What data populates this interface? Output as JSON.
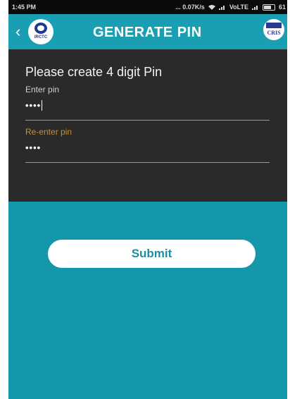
{
  "status_bar": {
    "time": "1:45 PM",
    "network_speed": "... 0.07K/s",
    "network_type": "VoLTE",
    "battery": "61"
  },
  "header": {
    "title": "GENERATE PIN",
    "left_logo_text": "IRCTC",
    "right_logo_text": "CRIS"
  },
  "form": {
    "heading": "Please create 4 digit Pin",
    "enter_pin": {
      "label": "Enter pin",
      "value": "••••"
    },
    "reenter_pin": {
      "label": "Re-enter pin",
      "value": "••••"
    }
  },
  "submit_label": "Submit",
  "colors": {
    "header": "#1a9fb2",
    "panel": "#2a2a2a",
    "background": "#1497aa",
    "accent_label": "#c9922e"
  }
}
